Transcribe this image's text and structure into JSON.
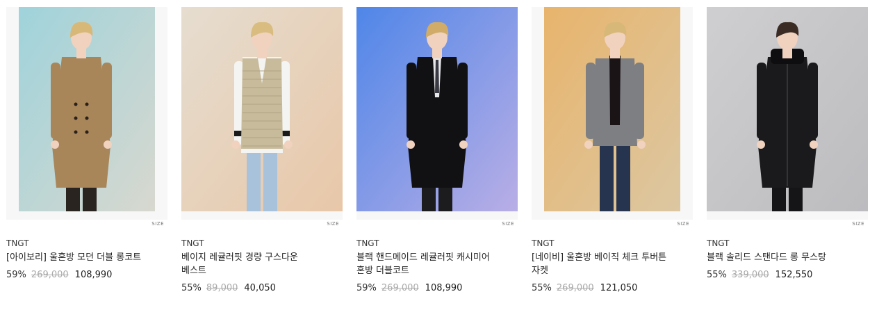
{
  "products": [
    {
      "brand": "TNGT",
      "name": "[아이보리] 울혼방 모던 더블 롱코트",
      "discount": "59%",
      "original_price": "269,000",
      "sale_price": "108,990",
      "size_label": "SIZE",
      "image": {
        "bg_top": "#9fd3db",
        "bg_bottom": "#d8d8cf",
        "garment": "#a8865a",
        "garment_type": "double-coat",
        "pants": "#2a2420",
        "hair": "#d8b878"
      }
    },
    {
      "brand": "TNGT",
      "name": "베이지 레귤러핏 경량 구스다운 베스트",
      "discount": "55%",
      "original_price": "89,000",
      "sale_price": "40,050",
      "size_label": "SIZE",
      "image": {
        "bg_top": "#e6ddd0",
        "bg_bottom": "#e8c7a8",
        "garment": "#c8bb9c",
        "garment_type": "vest",
        "pants": "#a8c2dc",
        "hair": "#d8bc80"
      }
    },
    {
      "brand": "TNGT",
      "name": "블랙 핸드메이드 레귤러핏 캐시미어 혼방 더블코트",
      "discount": "59%",
      "original_price": "269,000",
      "sale_price": "108,990",
      "size_label": "SIZE",
      "image": {
        "bg_top": "#4f86e8",
        "bg_bottom": "#b9aee6",
        "garment": "#111113",
        "garment_type": "black-coat",
        "pants": "#1c1c1e",
        "hair": "#d0ac68"
      }
    },
    {
      "brand": "TNGT",
      "name": "[네이비] 울혼방 베이직 체크 투버튼 자켓",
      "discount": "55%",
      "original_price": "269,000",
      "sale_price": "121,050",
      "size_label": "SIZE",
      "image": {
        "bg_top": "#e8b46c",
        "bg_bottom": "#dcc7a2",
        "garment": "#7e7f83",
        "garment_type": "blazer",
        "pants": "#263450",
        "hair": "#d8b878"
      }
    },
    {
      "brand": "TNGT",
      "name": "블랙 솔리드 스탠다드 롱 무스탕",
      "discount": "55%",
      "original_price": "339,000",
      "sale_price": "152,550",
      "size_label": "SIZE",
      "image": {
        "bg_top": "#cfcfd1",
        "bg_bottom": "#bcbcbf",
        "garment": "#1a1a1c",
        "garment_type": "mustang",
        "pants": "#151517",
        "hair": "#3a2c24"
      }
    }
  ]
}
